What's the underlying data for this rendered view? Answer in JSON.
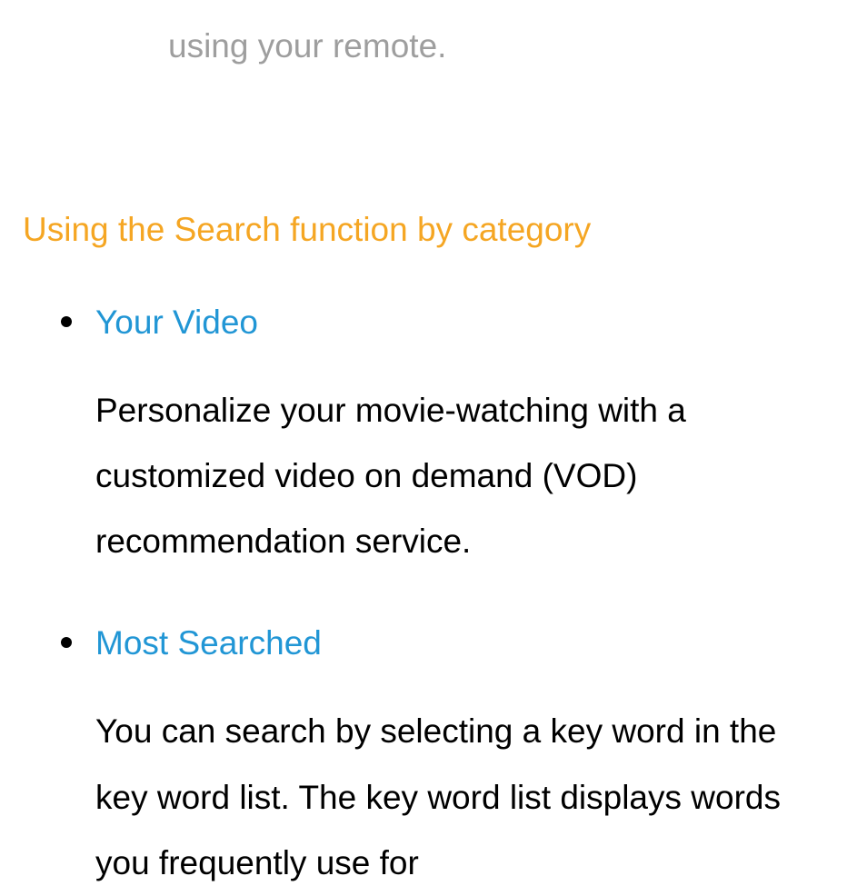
{
  "remoteFragment": "using your remote.",
  "heading": "Using the Search function by category",
  "items": [
    {
      "title": "Your Video",
      "body": "Personalize your movie-watching with a customized video on demand (VOD) recommendation service."
    },
    {
      "title": "Most Searched",
      "body": "You can search by selecting a key word in the key word list. The key word list displays words you frequently use for"
    }
  ]
}
